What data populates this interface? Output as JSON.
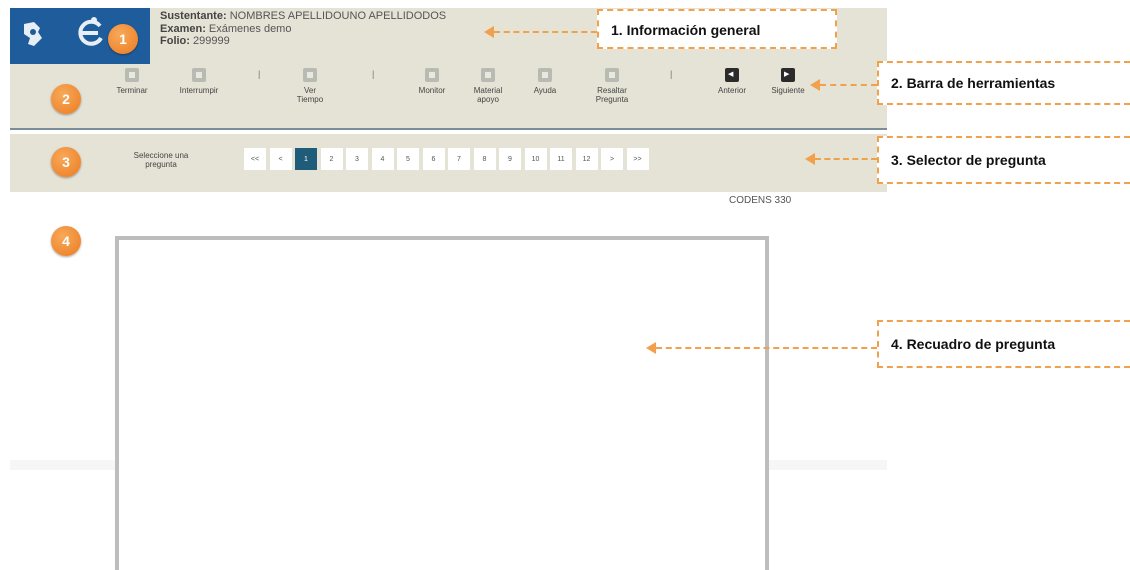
{
  "header": {
    "sustentante_label": "Sustentante:",
    "sustentante_value": "NOMBRES APELLIDOUNO APELLIDODOS",
    "examen_label": "Examen:",
    "examen_value": "Exámenes demo",
    "folio_label": "Folio:",
    "folio_value": "299999",
    "logo_icons": [
      "ceneval-logo",
      "examen-en-linea-logo"
    ]
  },
  "toolbar": {
    "terminar": "Terminar",
    "interrumpir": "Interrumpir",
    "ver_tiempo_1": "Ver",
    "ver_tiempo_2": "Tiempo",
    "monitor": "Monitor",
    "material_1": "Material",
    "material_2": "apoyo",
    "ayuda": "Ayuda",
    "resaltar_1": "Resaltar",
    "resaltar_2": "Pregunta",
    "anterior": "Anterior",
    "siguiente": "Siguiente",
    "separator": "|"
  },
  "selector": {
    "label_1": "Seleccione una",
    "label_2": "pregunta",
    "pages": [
      "<<",
      "<",
      "1",
      "2",
      "3",
      "4",
      "5",
      "6",
      "7",
      "8",
      "9",
      "10",
      "11",
      "12",
      ">",
      ">>"
    ],
    "active_page": "1"
  },
  "codens": "CODENS 330",
  "badges": [
    "1",
    "2",
    "3",
    "4"
  ],
  "callouts": {
    "c1": "1. Información general",
    "c2": "2. Barra de herramientas",
    "c3": "3. Selector de pregunta",
    "c4": "4. Recuadro de pregunta"
  },
  "colors": {
    "panel": "#e5e2d6",
    "accent_orange": "#ec7b1f",
    "dash_orange": "#f1a04c",
    "active_page": "#1f5c7a",
    "logo_blue": "#1f5c9c"
  }
}
